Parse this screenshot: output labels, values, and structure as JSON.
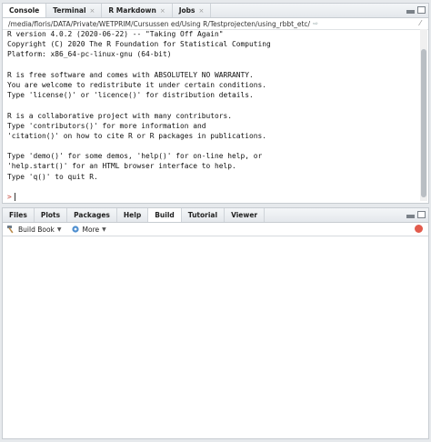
{
  "console_pane": {
    "tabs": [
      {
        "label": "Console",
        "closable": false
      },
      {
        "label": "Terminal",
        "closable": true
      },
      {
        "label": "R Markdown",
        "closable": true
      },
      {
        "label": "Jobs",
        "closable": true
      }
    ],
    "working_dir": "/media/floris/DATA/Private/WETPRIM/Cursussen ed/Using R/Testprojecten/using_rbbt_etc/",
    "lines": [
      "R version 4.0.2 (2020-06-22) -- \"Taking Off Again\"",
      "Copyright (C) 2020 The R Foundation for Statistical Computing",
      "Platform: x86_64-pc-linux-gnu (64-bit)",
      "",
      "R is free software and comes with ABSOLUTELY NO WARRANTY.",
      "You are welcome to redistribute it under certain conditions.",
      "Type 'license()' or 'licence()' for distribution details.",
      "",
      "R is a collaborative project with many contributors.",
      "Type 'contributors()' for more information and",
      "'citation()' on how to cite R or R packages in publications.",
      "",
      "Type 'demo()' for some demos, 'help()' for on-line help, or",
      "'help.start()' for an HTML browser interface to help.",
      "Type 'q()' to quit R.",
      ""
    ],
    "prompt": ">"
  },
  "files_pane": {
    "tabs": [
      {
        "label": "Files"
      },
      {
        "label": "Plots"
      },
      {
        "label": "Packages"
      },
      {
        "label": "Help"
      },
      {
        "label": "Build"
      },
      {
        "label": "Tutorial"
      },
      {
        "label": "Viewer"
      }
    ],
    "active_tab": "Build",
    "toolbar": {
      "build_book_label": "Build Book",
      "more_label": "More"
    }
  },
  "icons": {
    "close": "close-icon",
    "minimize": "minimize-icon",
    "maximize": "maximize-icon",
    "build": "hammer-icon",
    "more": "gear-icon",
    "stop": "stop-icon"
  },
  "colors": {
    "prompt": "#c0392b",
    "stop": "#e25b4c",
    "pane_border": "#c7ccd1"
  }
}
